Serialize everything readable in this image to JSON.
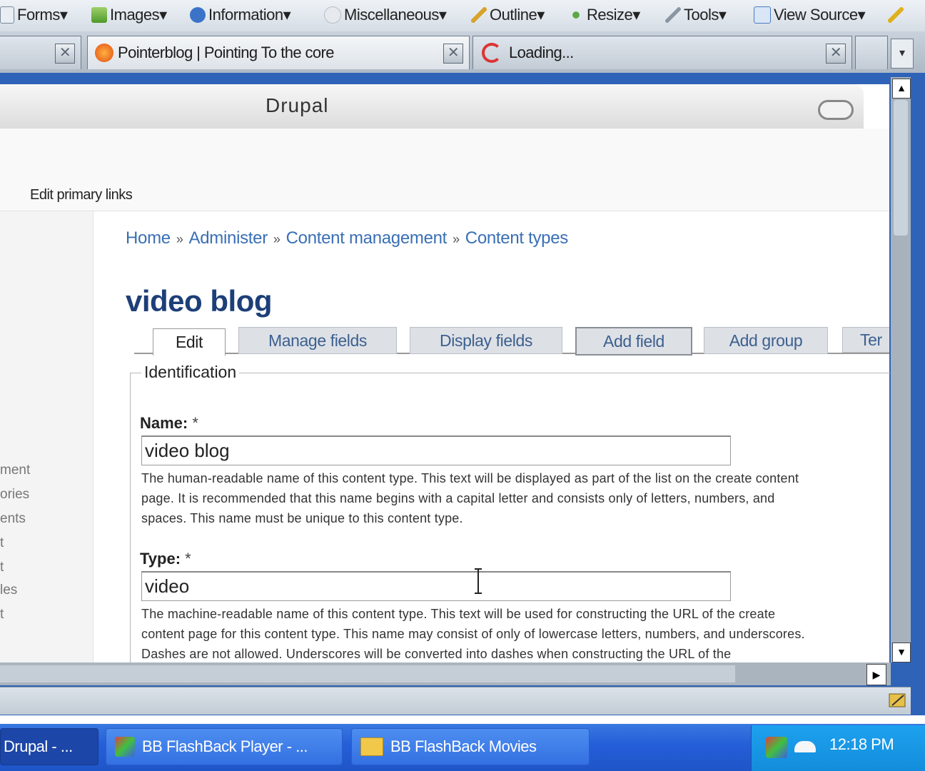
{
  "toolbar": {
    "items": [
      "Forms",
      "Images",
      "Information",
      "Miscellaneous",
      "Outline",
      "Resize",
      "Tools",
      "View Source"
    ]
  },
  "browser_tabs": [
    {
      "label": "Pointerblog | Pointing To the core"
    },
    {
      "label": "Loading..."
    }
  ],
  "window": {
    "title": "Drupal"
  },
  "header": {
    "primary_links": "Edit primary links"
  },
  "sidebar": {
    "items": [
      "ment",
      "ories",
      "ents",
      "t",
      "t",
      "les",
      "t"
    ]
  },
  "breadcrumb": [
    "Home",
    "Administer",
    "Content management",
    "Content types"
  ],
  "breadcrumb_sep": "»",
  "page": {
    "title": "video blog",
    "tabs": [
      "Edit",
      "Manage fields",
      "Display fields",
      "Add field",
      "Add group",
      "Ter"
    ]
  },
  "form": {
    "legend": "Identification",
    "name_label": "Name:",
    "name_value": "video blog",
    "name_desc": [
      "The human-readable name of this content type. This text will be displayed as part of the list on the create content",
      "page. It is recommended that this name begins with a capital letter and consists only of letters, numbers, and",
      "spaces. This name must be unique to this content type."
    ],
    "type_label": "Type:",
    "type_value": "video",
    "type_desc": [
      "The machine-readable name of this content type. This text will be used for constructing the URL of the create",
      "content page for this content type. This name may consist of only of lowercase letters, numbers, and underscores.",
      "Dashes are not allowed. Underscores will be converted into dashes when constructing the URL of the"
    ],
    "required_mark": "*"
  },
  "taskbar": {
    "items": [
      "Drupal - ...",
      "BB FlashBack Player - ...",
      "BB FlashBack Movies"
    ],
    "clock": "12:18 PM"
  },
  "colors": {
    "link": "#3a6fb5",
    "title": "#1d3f78",
    "taskbar": "#245ed8",
    "frame": "#2f63b8"
  }
}
